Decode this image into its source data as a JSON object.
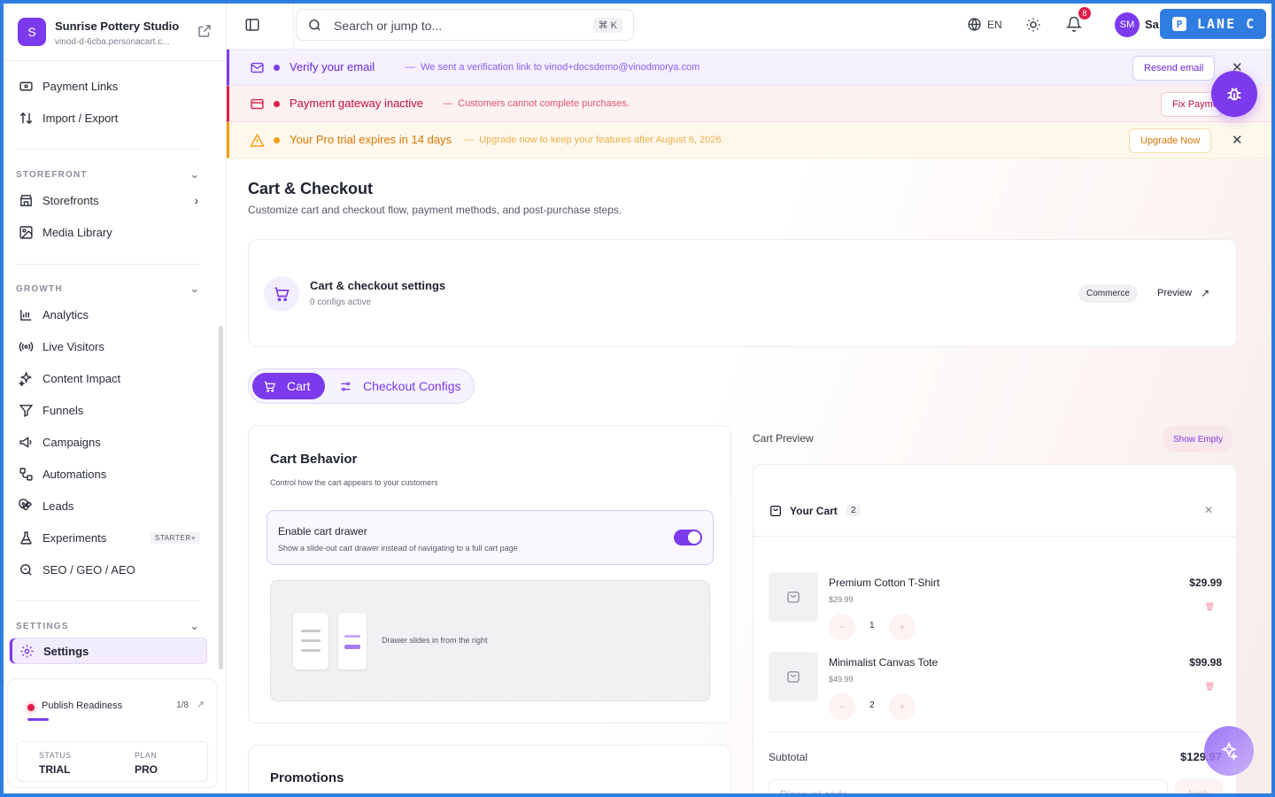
{
  "brand": {
    "initial": "S",
    "name": "Sunrise Pottery Studio",
    "subdomain": "vinod-d-6cba.personacart.c..."
  },
  "sidebar": {
    "top_items": [
      {
        "label": "Payment Links",
        "icon": "card-icon"
      },
      {
        "label": "Import / Export",
        "icon": "arrows-updown-icon"
      }
    ],
    "storefront": {
      "heading": "STOREFRONT",
      "items": [
        {
          "label": "Storefronts",
          "icon": "store-icon"
        },
        {
          "label": "Media Library",
          "icon": "image-icon"
        }
      ]
    },
    "growth": {
      "heading": "GROWTH",
      "items": [
        {
          "label": "Analytics",
          "icon": "bar-chart-icon"
        },
        {
          "label": "Live Visitors",
          "icon": "radio-icon"
        },
        {
          "label": "Content Impact",
          "icon": "sparkles-icon"
        },
        {
          "label": "Funnels",
          "icon": "funnel-icon"
        },
        {
          "label": "Campaigns",
          "icon": "megaphone-icon"
        },
        {
          "label": "Automations",
          "icon": "workflow-icon"
        },
        {
          "label": "Leads",
          "icon": "magnet-icon"
        },
        {
          "label": "Experiments",
          "icon": "flask-icon",
          "badge": "STARTER+"
        },
        {
          "label": "SEO / GEO / AEO",
          "icon": "search-icon"
        }
      ]
    },
    "settings": {
      "heading": "SETTINGS",
      "items": [
        {
          "label": "Settings",
          "icon": "gear-icon"
        }
      ]
    },
    "readiness": {
      "title": "Publish Readiness",
      "count": "1/8",
      "progress": 0.125,
      "status_label": "STATUS",
      "status_value": "TRIAL",
      "plan_label": "PLAN",
      "plan_value": "PRO"
    }
  },
  "topbar": {
    "search_placeholder": "Search or jump to...",
    "shortcut": "⌘ K",
    "language": "EN",
    "notifications": "8",
    "avatar_initials": "SM",
    "user_name": "Sa",
    "lane_badge": "LANE C",
    "lane_badge_icon": "P"
  },
  "banners": [
    {
      "title": "Verify your email",
      "separator": "—",
      "desc": "We sent a verification link to vinod+docsdemo@vinodmorya.com",
      "button": "Resend email",
      "icon": "mail-icon"
    },
    {
      "title": "Payment gateway inactive",
      "separator": "—",
      "desc": "Customers cannot complete purchases.",
      "button": "Fix Payments",
      "icon": "card-icon"
    },
    {
      "title": "Your Pro trial expires in 14 days",
      "separator": "—",
      "desc": "Upgrade now to keep your features after August 6, 2026.",
      "button": "Upgrade Now",
      "icon": "warning-icon"
    }
  ],
  "page": {
    "title": "Cart & Checkout",
    "subtitle": "Customize cart and checkout flow, payment methods, and post-purchase steps."
  },
  "settings_card": {
    "title": "Cart & checkout settings",
    "sub": "0 configs active",
    "chip": "Commerce",
    "preview": "Preview"
  },
  "tabs": [
    {
      "label": "Cart"
    },
    {
      "label": "Checkout Configs"
    }
  ],
  "behavior": {
    "title": "Cart Behavior",
    "sub": "Control how the cart appears to your customers",
    "toggle_title": "Enable cart drawer",
    "toggle_sub": "Show a slide-out cart drawer instead of navigating to a full cart page",
    "toggle_on": true,
    "demo_text": "Drawer slides in from the right"
  },
  "promotions": {
    "title": "Promotions"
  },
  "cart_preview": {
    "label": "Cart Preview",
    "show_empty": "Show Empty",
    "title": "Your Cart",
    "count": "2",
    "items": [
      {
        "name": "Premium Cotton T-Shirt",
        "unit_price": "$29.99",
        "qty": "1",
        "total": "$29.99"
      },
      {
        "name": "Minimalist Canvas Tote",
        "unit_price": "$49.99",
        "qty": "2",
        "total": "$99.98"
      }
    ],
    "subtotal_label": "Subtotal",
    "subtotal": "$129.97",
    "discount_placeholder": "Discount code",
    "apply": "Apply"
  }
}
